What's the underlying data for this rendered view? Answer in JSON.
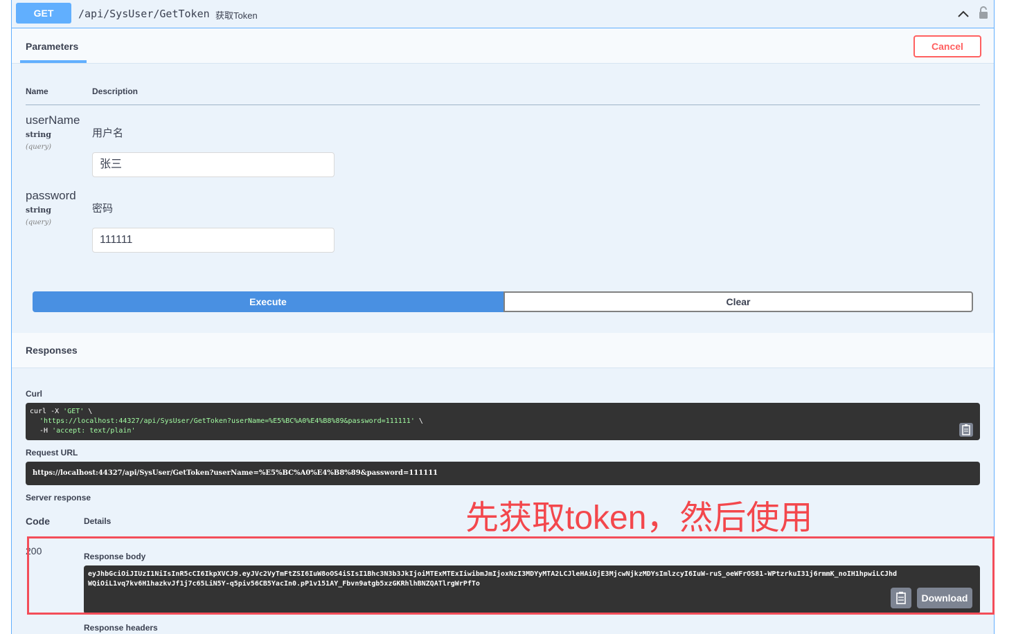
{
  "summary": {
    "method": "GET",
    "path": "/api/SysUser/GetToken",
    "description": "获取Token"
  },
  "tabs": {
    "parameters": "Parameters"
  },
  "cancel_label": "Cancel",
  "table": {
    "name_header": "Name",
    "description_header": "Description"
  },
  "params": [
    {
      "name": "userName",
      "type": "string",
      "in": "(query)",
      "description": "用户名",
      "value": "张三"
    },
    {
      "name": "password",
      "type": "string",
      "in": "(query)",
      "description": "密码",
      "value": "111111"
    }
  ],
  "buttons": {
    "execute": "Execute",
    "clear": "Clear"
  },
  "responses": {
    "title": "Responses",
    "curl_label": "Curl",
    "curl_line1_a": "curl -X ",
    "curl_line1_b": "'GET'",
    "curl_line1_c": " \\",
    "curl_line2": "'https://localhost:44327/api/SysUser/GetToken?userName=%E5%BC%A0%E4%B8%89&password=111111'",
    "curl_line2_tail": " \\",
    "curl_line3_a": "-H ",
    "curl_line3_b": "'accept: text/plain'",
    "request_url_label": "Request URL",
    "request_url": "https://localhost:44327/api/SysUser/GetToken?userName=%E5%BC%A0%E4%B8%89&password=111111",
    "server_response_label": "Server response",
    "code_header": "Code",
    "details_header": "Details",
    "status_code": "200",
    "response_body_label": "Response body",
    "body_line1": "eyJhbGciOiJIUzI1NiIsInR5cCI6IkpXVCJ9.eyJVc2VyTmFtZSI6IuW8oOS4iSIsI1Bhc3N3b3JkIjoiMTExMTExIiwibmJmIjoxNzI3MDYyMTA2LCJleHAiOjE3MjcwNjkzMDYsImlzcyI6IuW-ruS_oeWFrOS81-WPtzrkuI31j6rmmK_noIH1hpwiLCJhd",
    "body_line2": "WQiOiL1vq7kv6H1hazkvJf1j7c65LiN5Y-q5piv56CB5YacIn0.pP1v151AY_Fbvn9atgb5xzGKRhlhBNZQATlrgWrPfTo",
    "download_label": "Download",
    "response_headers_label": "Response headers"
  },
  "annotation": "先获取token，然后使用",
  "colors": {
    "get": "#61affe",
    "execute": "#4990e2",
    "cancel": "#ff6060",
    "annotation": "#f3474c"
  }
}
